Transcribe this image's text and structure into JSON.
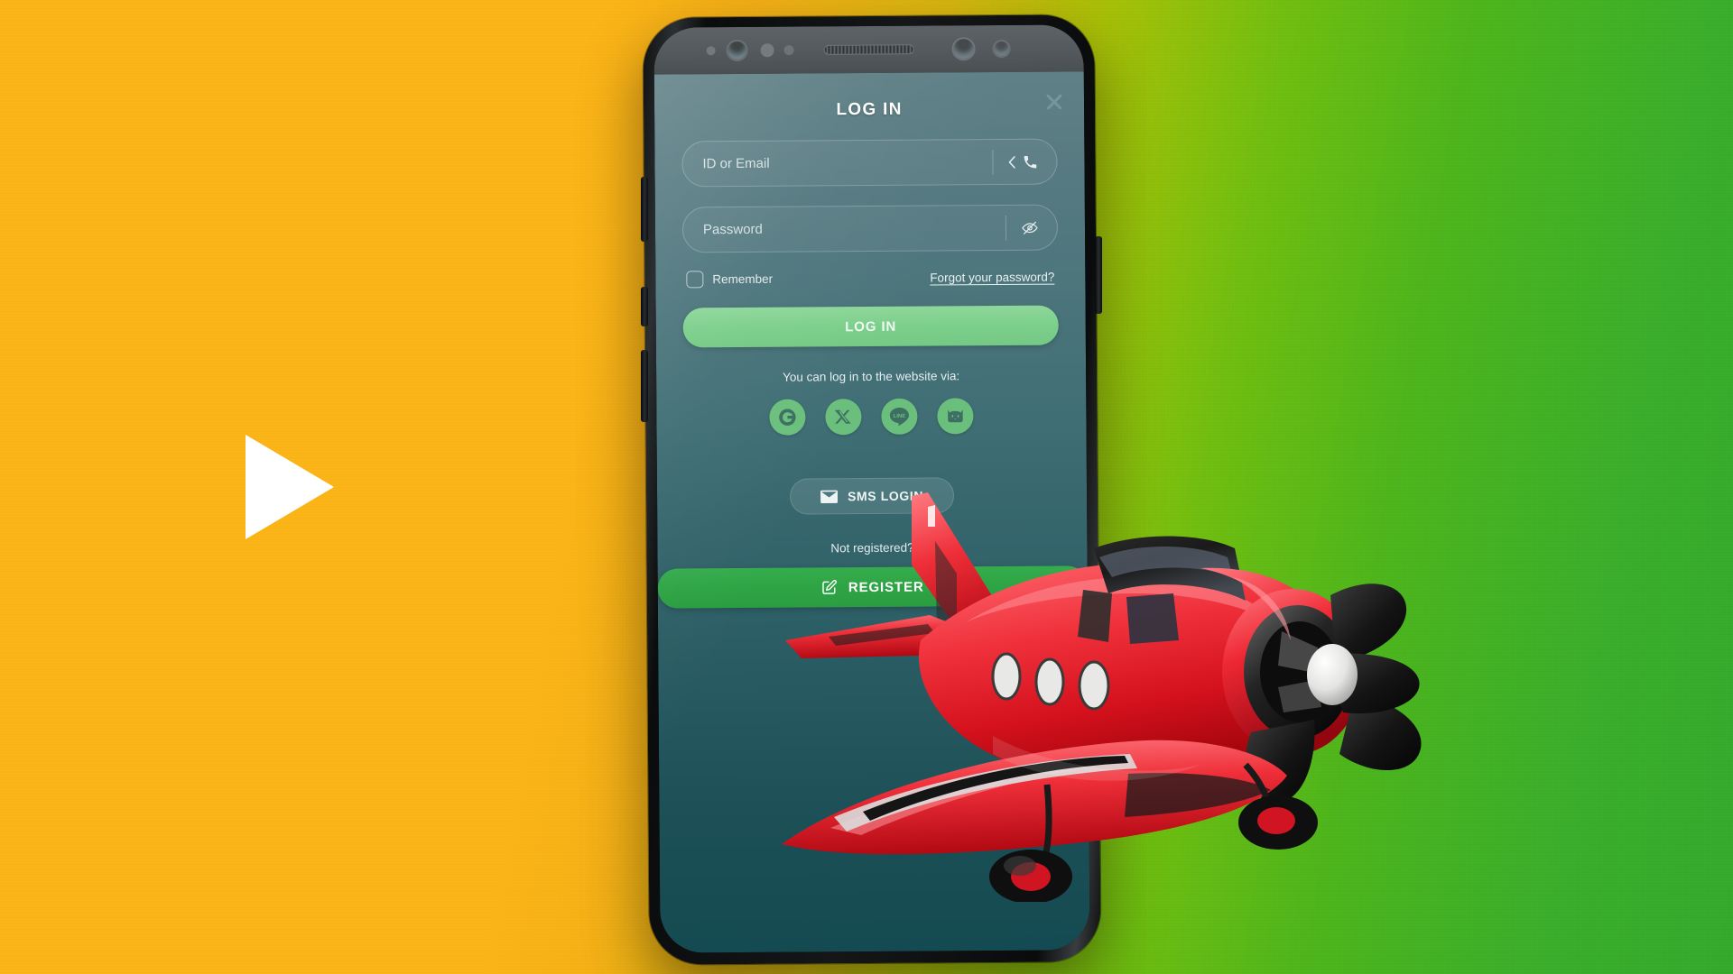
{
  "background": {
    "gradient_from": "#FBB417",
    "gradient_to": "#3AAD2B",
    "play_icon": "play-triangle-icon"
  },
  "phone": {
    "device": "smartphone-mockup",
    "screen_bg": "#2d5f66",
    "sensors": [
      "proximity-sensor",
      "front-camera",
      "iris-scanner",
      "light-sensor",
      "earpiece-speaker",
      "secondary-camera",
      "led-indicator"
    ]
  },
  "app": {
    "title": "LOG IN",
    "close_icon": "close-icon",
    "fields": [
      {
        "name": "id-or-email",
        "placeholder": "ID or Email",
        "value": "",
        "adornment_icons": [
          "chevron-left-icon",
          "phone-icon"
        ]
      },
      {
        "name": "password",
        "placeholder": "Password",
        "value": "",
        "adornment_icons": [
          "eye-slash-icon"
        ]
      }
    ],
    "remember": {
      "label": "Remember",
      "checked": false
    },
    "forgot_link": "Forgot your password?",
    "login_button": "LOG IN",
    "login_button_color": "#7ccf8b",
    "social_prompt": "You can log in to the website via:",
    "socials": [
      {
        "name": "google",
        "icon": "google-g-icon",
        "label": "G"
      },
      {
        "name": "x",
        "icon": "x-twitter-icon",
        "label": "X"
      },
      {
        "name": "line",
        "icon": "line-icon",
        "label": "LINE"
      },
      {
        "name": "cat",
        "icon": "cat-face-icon",
        "label": ""
      }
    ],
    "social_bg": "#6bbf7c",
    "sms_button": {
      "label": "SMS LOGIN",
      "icon": "envelope-icon"
    },
    "not_registered": "Not registered?",
    "register_button": {
      "label": "REGISTER",
      "icon": "pencil-square-icon",
      "color": "#2ea344"
    }
  },
  "decoration": {
    "airplane": {
      "name": "red-toy-airplane",
      "body_color": "#e8202a",
      "accent_color": "#f4555d",
      "propeller_color": "#1b1b1b"
    }
  }
}
